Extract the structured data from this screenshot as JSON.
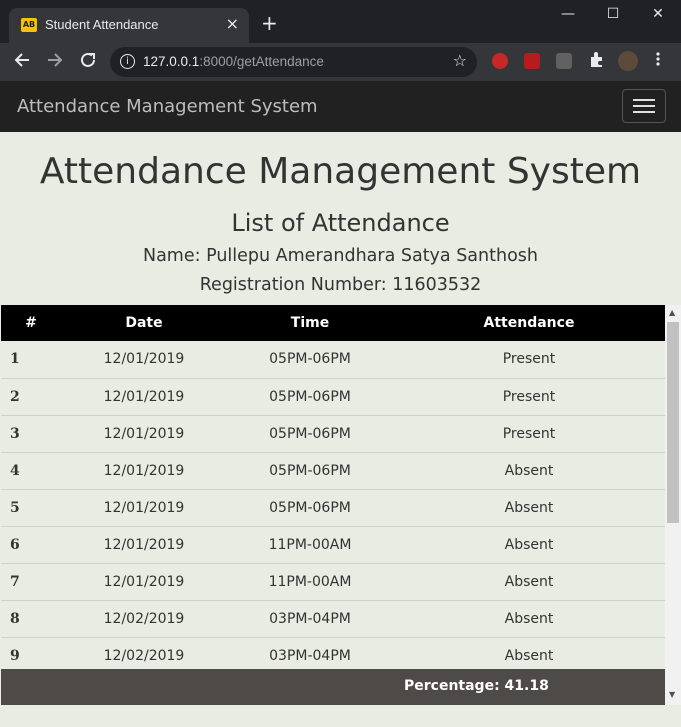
{
  "browser": {
    "tab_title": "Student Attendance",
    "tab_favicon_text": "AB",
    "tab_close": "×",
    "new_tab": "+",
    "url_host": "127.0.0.1",
    "url_rest": ":8000/getAttendance",
    "window_controls": {
      "minimize": "—",
      "maximize": "☐",
      "close": "✕"
    }
  },
  "navbar": {
    "brand": "Attendance Management System"
  },
  "page": {
    "title": "Attendance Management System",
    "subtitle": "List of Attendance",
    "name_line": "Name: Pullepu Amerandhara Satya Santhosh",
    "reg_line": "Registration Number: 11603532"
  },
  "table": {
    "headers": [
      "#",
      "Date",
      "Time",
      "Attendance"
    ],
    "rows": [
      [
        "1",
        "12/01/2019",
        "05PM-06PM",
        "Present"
      ],
      [
        "2",
        "12/01/2019",
        "05PM-06PM",
        "Present"
      ],
      [
        "3",
        "12/01/2019",
        "05PM-06PM",
        "Present"
      ],
      [
        "4",
        "12/01/2019",
        "05PM-06PM",
        "Absent"
      ],
      [
        "5",
        "12/01/2019",
        "05PM-06PM",
        "Absent"
      ],
      [
        "6",
        "12/01/2019",
        "11PM-00AM",
        "Absent"
      ],
      [
        "7",
        "12/01/2019",
        "11PM-00AM",
        "Absent"
      ],
      [
        "8",
        "12/02/2019",
        "03PM-04PM",
        "Absent"
      ],
      [
        "9",
        "12/02/2019",
        "03PM-04PM",
        "Absent"
      ]
    ],
    "percentage": "Percentage: 41.18"
  },
  "colors": {
    "navbar": "#212121",
    "table_header": "#000000",
    "footer_bar": "#4e4a47",
    "page_bg": "#e8ece3"
  }
}
